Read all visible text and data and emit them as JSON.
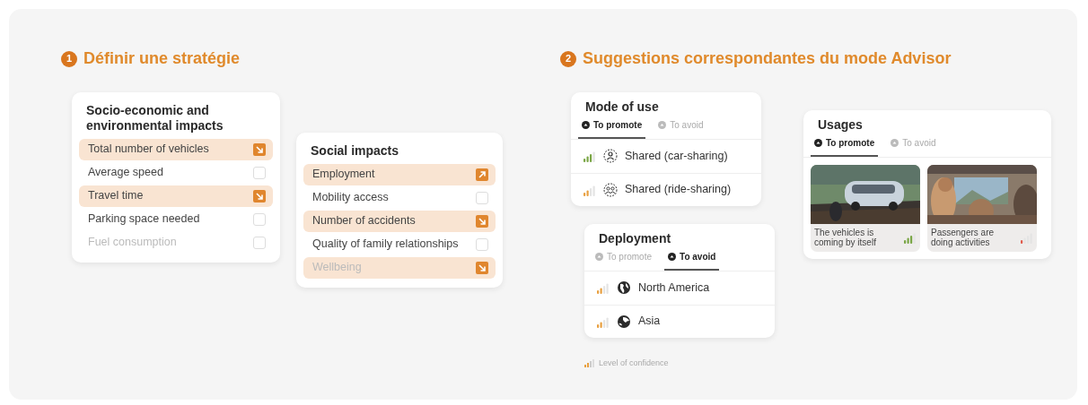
{
  "strategy": {
    "number": "1",
    "title": "Définir une stratégie",
    "cards": [
      {
        "title": "Socio-economic and environmental impacts",
        "items": [
          {
            "label": "Total number of vehicles",
            "selected": true,
            "kind": "decrease"
          },
          {
            "label": "Average speed",
            "selected": false
          },
          {
            "label": "Travel time",
            "selected": true,
            "kind": "decrease"
          },
          {
            "label": "Parking space needed",
            "selected": false
          },
          {
            "label": "Fuel consumption",
            "selected": false
          }
        ]
      },
      {
        "title": "Social impacts",
        "items": [
          {
            "label": "Employment",
            "selected": true,
            "kind": "increase"
          },
          {
            "label": "Mobility access",
            "selected": false
          },
          {
            "label": "Number of accidents",
            "selected": true,
            "kind": "decrease"
          },
          {
            "label": "Quality of family relationships",
            "selected": false
          },
          {
            "label": "Wellbeing",
            "selected": true,
            "kind": "decrease"
          }
        ]
      }
    ]
  },
  "advisor": {
    "number": "2",
    "title": "Suggestions correspondantes du mode Advisor",
    "mode_of_use": {
      "title": "Mode of use",
      "tabs": [
        {
          "label": "To promote",
          "selected": true
        },
        {
          "label": "To avoid",
          "selected": false
        }
      ],
      "rows": [
        {
          "label": "Shared (car-sharing)",
          "kind": "person",
          "level": 0.75
        },
        {
          "label": "Shared (ride-sharing)",
          "kind": "group",
          "level": 0.5
        }
      ]
    },
    "deployment": {
      "title": "Deployment",
      "tabs": [
        {
          "label": "To promote",
          "selected": false
        },
        {
          "label": "To avoid",
          "selected": true
        }
      ],
      "rows": [
        {
          "label": "North America",
          "kind": "americas",
          "level": 0.5
        },
        {
          "label": "Asia",
          "kind": "asia",
          "level": 0.5
        }
      ]
    },
    "legend": "Level of confidence",
    "usages": {
      "title": "Usages",
      "tabs": [
        {
          "label": "To promote",
          "selected": true
        },
        {
          "label": "To avoid",
          "selected": false
        }
      ],
      "cards": [
        {
          "kind": "picture",
          "caption": "The vehicles is coming by itself",
          "level": 0.75
        },
        {
          "kind": "picture",
          "caption": "Passengers are doing activities",
          "level": 0.25
        }
      ]
    }
  }
}
